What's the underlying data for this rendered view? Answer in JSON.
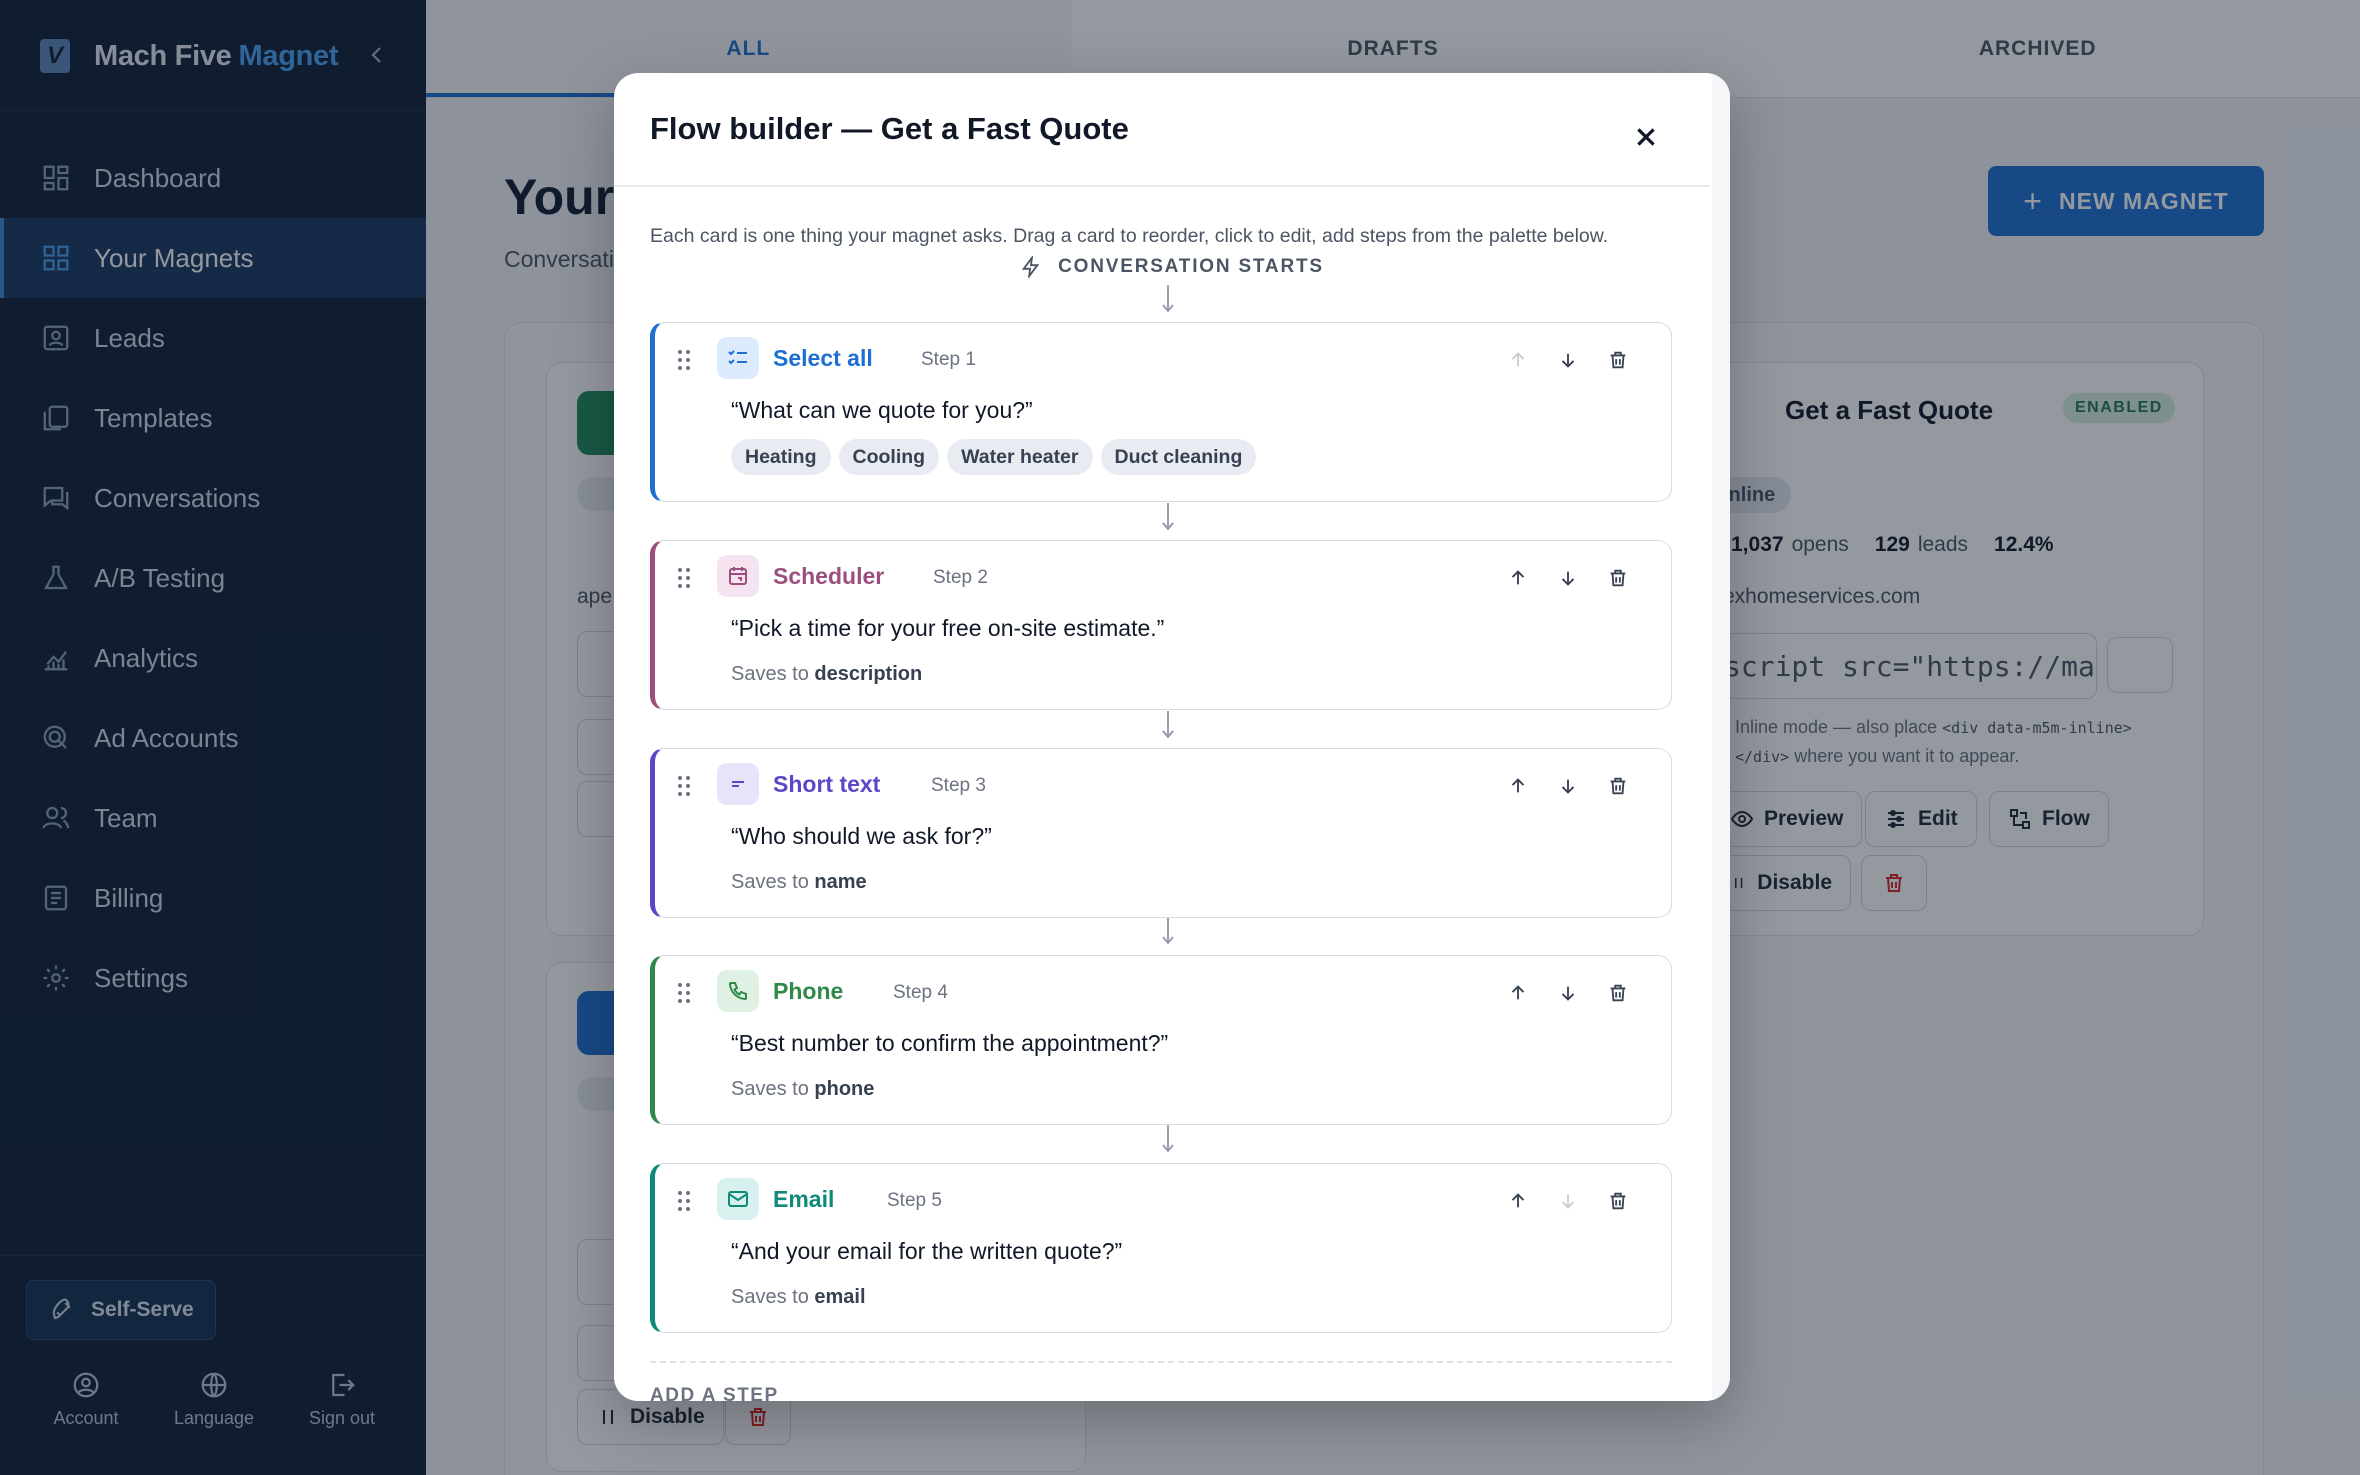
{
  "brand": {
    "name": "Mach Five",
    "accent": "Magnet",
    "logo_letter": "V"
  },
  "sidebar": {
    "items": [
      {
        "label": "Dashboard",
        "icon": "dashboard-icon"
      },
      {
        "label": "Your Magnets",
        "icon": "magnets-icon"
      },
      {
        "label": "Leads",
        "icon": "leads-icon"
      },
      {
        "label": "Templates",
        "icon": "templates-icon"
      },
      {
        "label": "Conversations",
        "icon": "conversations-icon"
      },
      {
        "label": "A/B Testing",
        "icon": "flask-icon"
      },
      {
        "label": "Analytics",
        "icon": "analytics-icon"
      },
      {
        "label": "Ad Accounts",
        "icon": "ad-accounts-icon"
      },
      {
        "label": "Team",
        "icon": "team-icon"
      },
      {
        "label": "Billing",
        "icon": "billing-icon"
      },
      {
        "label": "Settings",
        "icon": "gear-icon"
      }
    ],
    "active_index": 1,
    "self_serve": "Self-Serve",
    "footer": {
      "account": "Account",
      "language": "Language",
      "sign_out": "Sign out"
    }
  },
  "tabs": [
    "ALL",
    "DRAFTS",
    "ARCHIVED"
  ],
  "page": {
    "title": "Your",
    "subtitle": "Conversati",
    "new_button": "NEW MAGNET"
  },
  "background_cards": {
    "left_partial": {
      "domain_fragment": "ape",
      "disable_label": "Disable"
    },
    "right_card": {
      "title": "Get a Fast Quote",
      "status": "ENABLED",
      "mode": "Inline",
      "opens": "1,037",
      "opens_label": "opens",
      "leads": "129",
      "leads_label": "leads",
      "rate": "12.4%",
      "domain": "exhomeservices.com",
      "snippet": "script src=\"https://ma",
      "hint_prefix": "Inline mode — also place",
      "hint_code1": "<div data-m5m-inline>",
      "hint_code2": "</div>",
      "hint_suffix": "where you want it to appear.",
      "preview": "Preview",
      "edit": "Edit",
      "flow": "Flow",
      "disable": "Disable"
    }
  },
  "colors": {
    "sidebar": "#0f2038",
    "accent": "#1d6fd1",
    "brand_accent": "#4aa3f0",
    "enabled": "#1f7a4b"
  },
  "modal": {
    "title": "Flow builder — Get a Fast Quote",
    "description": "Each card is one thing your magnet asks. Drag a card to reorder, click to edit, add steps from the palette below.",
    "start_label": "CONVERSATION STARTS",
    "add_step_label": "ADD A STEP",
    "saves_prefix": "Saves to",
    "steps": [
      {
        "type": "Select all",
        "step": "Step 1",
        "question": "“What can we quote for you?”",
        "options": [
          "Heating",
          "Cooling",
          "Water heater",
          "Duct cleaning"
        ],
        "icon": "checklist-icon",
        "color": "#1d6fd1"
      },
      {
        "type": "Scheduler",
        "step": "Step 2",
        "question": "“Pick a time for your free on-site estimate.”",
        "saves_to": "description",
        "icon": "calendar-icon",
        "color": "#9b4f7e"
      },
      {
        "type": "Short text",
        "step": "Step 3",
        "question": "“Who should we ask for?”",
        "saves_to": "name",
        "icon": "text-lines-icon",
        "color": "#5b47c7"
      },
      {
        "type": "Phone",
        "step": "Step 4",
        "question": "“Best number to confirm the appointment?”",
        "saves_to": "phone",
        "icon": "phone-icon",
        "color": "#2f8a4a"
      },
      {
        "type": "Email",
        "step": "Step 5",
        "question": "“And your email for the written quote?”",
        "saves_to": "email",
        "icon": "mail-icon",
        "color": "#0f8a78"
      }
    ]
  }
}
